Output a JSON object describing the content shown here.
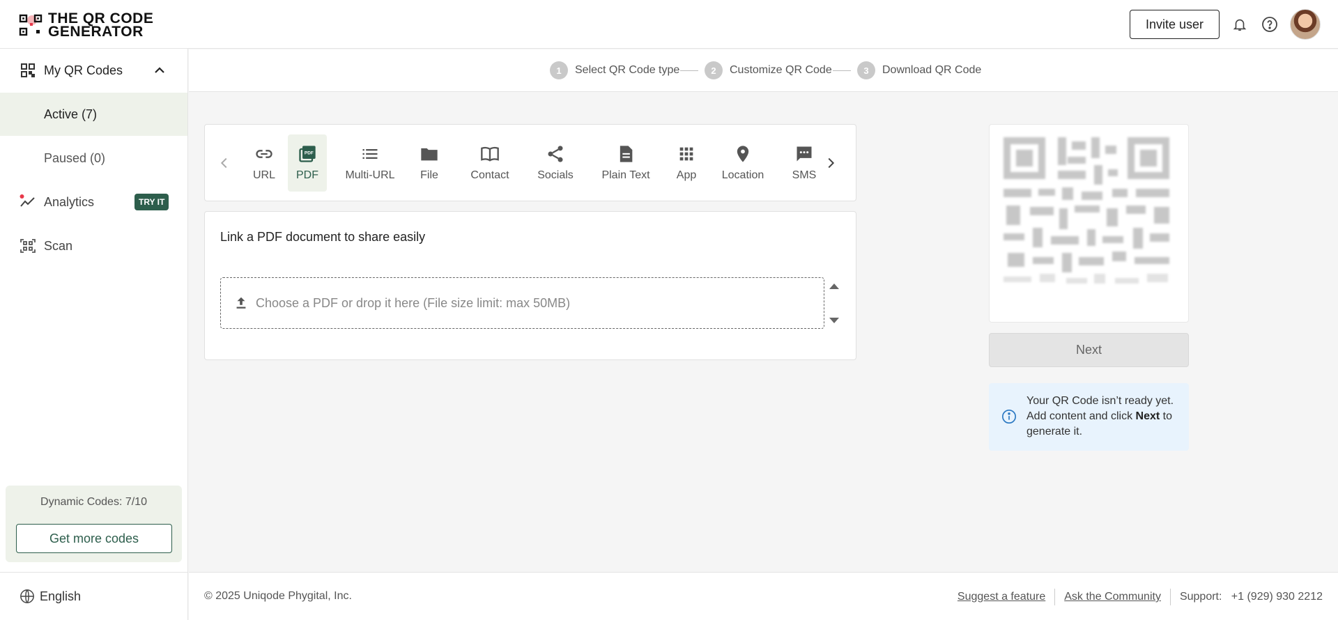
{
  "header": {
    "logo_line1": "THE QR CODE",
    "logo_line2": "GENERATOR",
    "invite_label": "Invite user",
    "icons": [
      "bell-icon",
      "help-icon"
    ]
  },
  "sidebar": {
    "my_qr_codes": "My QR Codes",
    "active": "Active (7)",
    "paused": "Paused (0)",
    "analytics": "Analytics",
    "analytics_badge": "TRY IT",
    "scan": "Scan",
    "quota_text": "Dynamic Codes: 7/10",
    "more_codes": "Get more codes",
    "language": "English"
  },
  "stepper": {
    "steps": [
      {
        "num": "1",
        "label": "Select QR Code type"
      },
      {
        "num": "2",
        "label": "Customize QR Code"
      },
      {
        "num": "3",
        "label": "Download QR Code"
      }
    ]
  },
  "types": {
    "selected": "PDF",
    "items": [
      {
        "label": "URL",
        "icon": "link-icon"
      },
      {
        "label": "PDF",
        "icon": "pdf-icon"
      },
      {
        "label": "Multi-URL",
        "icon": "list-icon"
      },
      {
        "label": "File",
        "icon": "folder-icon"
      },
      {
        "label": "Contact",
        "icon": "contact-book-icon"
      },
      {
        "label": "Socials",
        "icon": "share-icon"
      },
      {
        "label": "Plain Text",
        "icon": "document-icon"
      },
      {
        "label": "App",
        "icon": "apps-grid-icon"
      },
      {
        "label": "Location",
        "icon": "location-pin-icon"
      },
      {
        "label": "SMS",
        "icon": "sms-icon"
      }
    ]
  },
  "content": {
    "title": "Link a PDF document to share easily",
    "dropzone_text": "Choose a PDF or drop it here (File size limit: max 50MB)"
  },
  "preview": {
    "next_label": "Next",
    "info_prefix": "Your QR Code isn’t ready yet. Add content and click ",
    "info_bold": "Next",
    "info_suffix": " to generate it."
  },
  "footer": {
    "copyright": "© 2025 Uniqode Phygital, Inc.",
    "suggest": "Suggest a feature",
    "community": "Ask the Community",
    "support": "Support:   +1 (929) 930 2212"
  },
  "colors": {
    "brand_green": "#2d5e4c",
    "selected_bg": "#eef2ea",
    "info_bg": "#e8f3fd",
    "logo_accent": "#e8394a"
  }
}
